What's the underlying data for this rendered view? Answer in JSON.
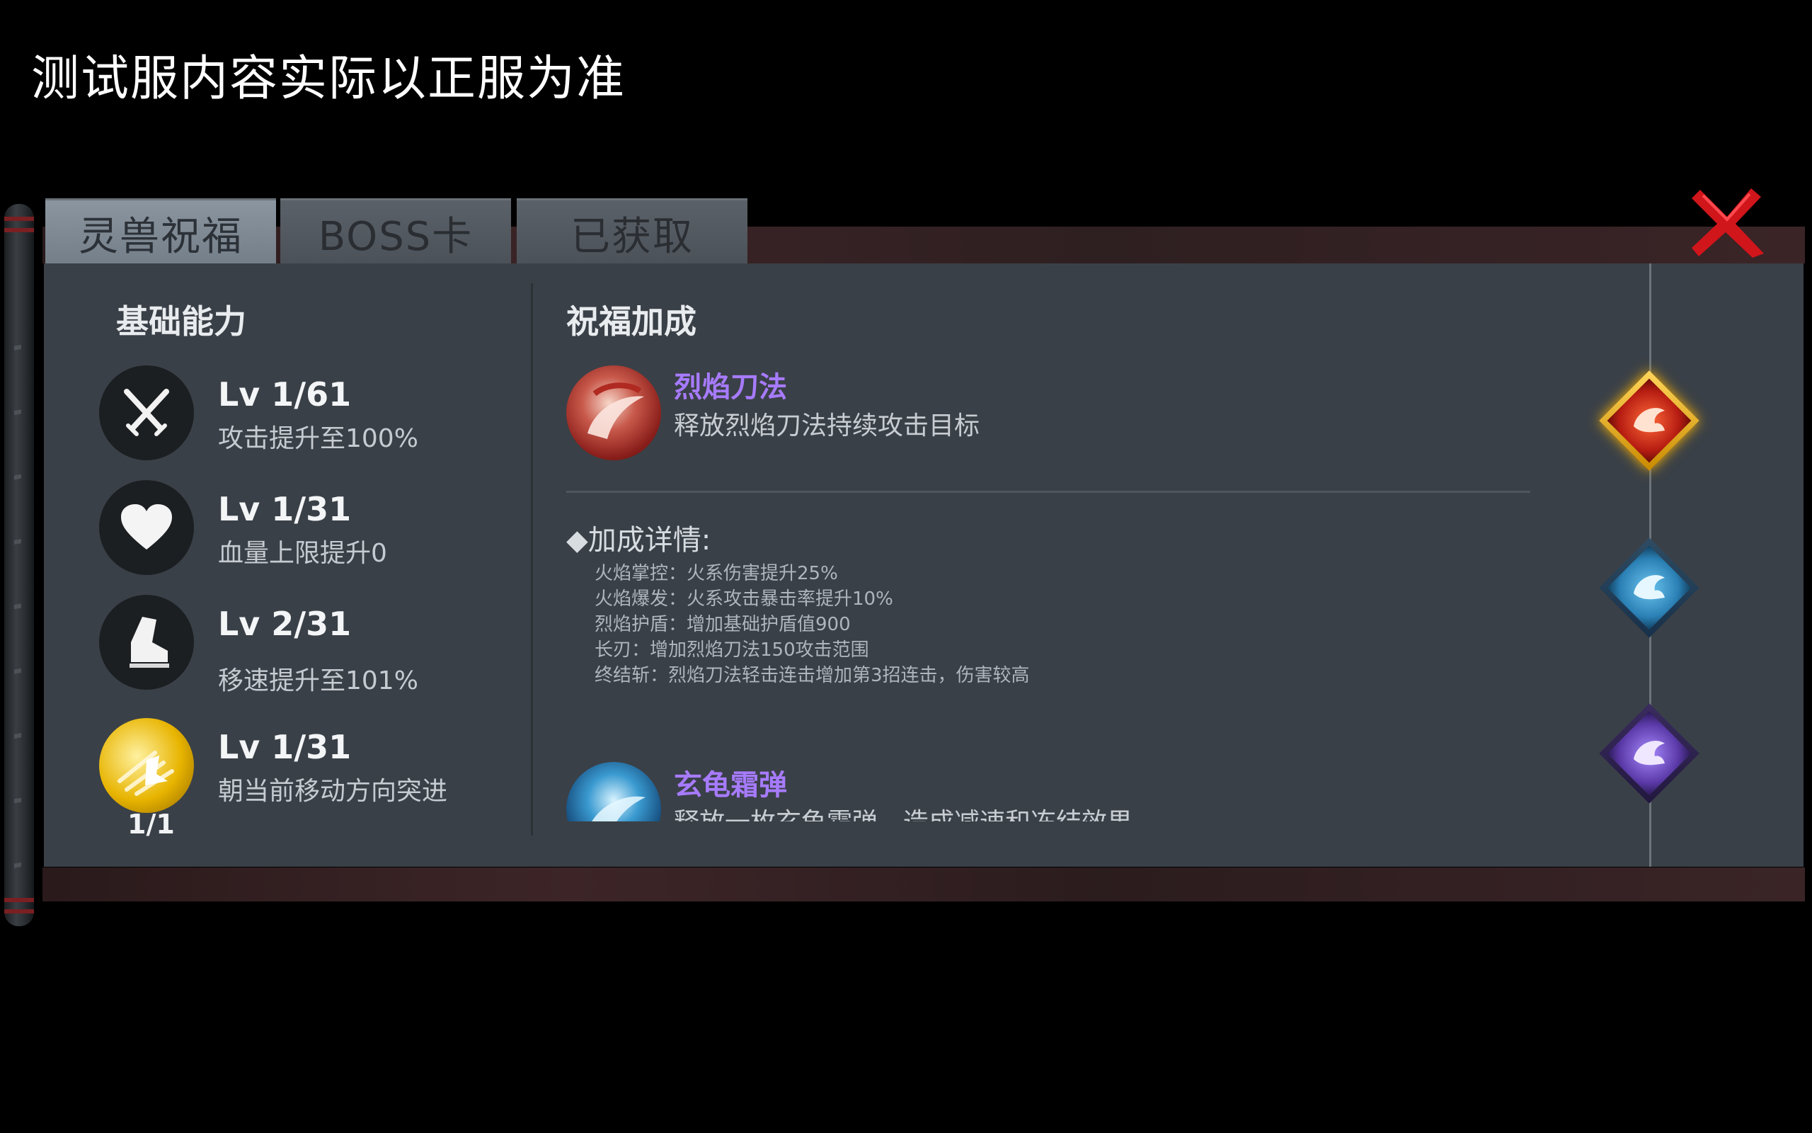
{
  "notice": "测试服内容实际以正服为准",
  "tabs": [
    "灵兽祝福",
    "BOSS卡",
    "已获取"
  ],
  "active_tab": 0,
  "left": {
    "title": "基础能力",
    "stats": [
      {
        "icon": "swords-icon",
        "level": "Lv 1/61",
        "desc": "攻击提升至100%"
      },
      {
        "icon": "heart-icon",
        "level": "Lv 1/31",
        "desc": "血量上限提升0"
      },
      {
        "icon": "boot-icon",
        "level": "Lv 2/31",
        "desc": "移速提升至101%"
      },
      {
        "icon": "dash-icon",
        "level": "Lv 1/31",
        "desc": "朝当前移动方向突进",
        "count": "1/1"
      }
    ]
  },
  "right": {
    "title": "祝福加成",
    "skill1": {
      "name": "烈焰刀法",
      "desc": "释放烈焰刀法持续攻击目标"
    },
    "detail_title": "◆加成详情:",
    "details": [
      "火焰掌控：火系伤害提升25%",
      "火焰爆发：火系攻击暴击率提升10%",
      "烈焰护盾：增加基础护盾值900",
      "长刃：增加烈焰刀法150攻击范围",
      "终结斩：烈焰刀法轻击连击增加第3招连击，伤害较高"
    ],
    "skill2": {
      "name": "玄龟霜弹",
      "desc": "释放一枚玄龟霜弹，造成减速和冻结效果"
    }
  },
  "badges": [
    {
      "name": "fire-dragon-badge-icon",
      "color": "#e0442a"
    },
    {
      "name": "water-dragon-badge-icon",
      "color": "#3a9ad0"
    },
    {
      "name": "purple-dragon-badge-icon",
      "color": "#7b55c8"
    }
  ],
  "colors": {
    "accent_purple": "#a77bff",
    "close_red": "#d0151b",
    "panel": "#3a4047"
  }
}
